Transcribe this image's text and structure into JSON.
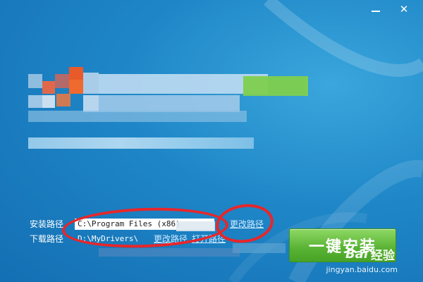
{
  "window": {
    "controls": {
      "minimize_icon": "minimize-icon",
      "close_icon": "close-icon",
      "close_glyph": "✕"
    }
  },
  "paths": {
    "install_label": "安装路径",
    "install_value": "C:\\Program Files (x86)",
    "install_change_link": "更改路径",
    "download_label": "下载路径",
    "download_value": "D:\\MyDrivers\\",
    "download_change_link": "更改路径",
    "download_open_link": "打开路径"
  },
  "install_button": {
    "label": "一键安装"
  },
  "watermark": {
    "logo": "Bai",
    "text": "经验",
    "sub": "jingyan.baidu.com"
  },
  "colors": {
    "accent_green": "#58b233",
    "annotation_red": "#e8262a",
    "window_blue": "#1e86c7"
  }
}
